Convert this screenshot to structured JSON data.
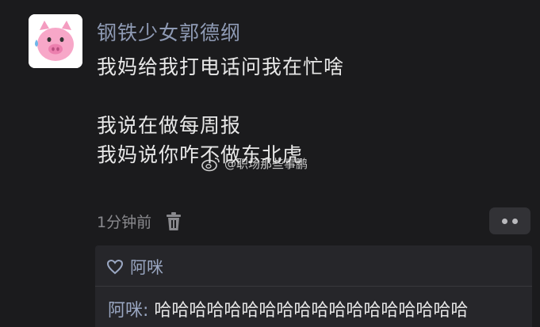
{
  "post": {
    "username": "钢铁少女郭德纲",
    "lines": [
      "我妈给我打电话问我在忙啥",
      "我说在做每周报",
      "我妈说你咋不做东北虎"
    ],
    "time": "1分钟前"
  },
  "watermark": {
    "text": "@职场那些事鹏"
  },
  "reply_panel": {
    "liker": "阿咪",
    "reply_name": "阿咪:",
    "reply_text": "哈哈哈哈哈哈哈哈哈哈哈哈哈哈哈哈哈哈"
  },
  "icons": {
    "avatar": "pig-face-sweat-icon",
    "delete": "trash-icon",
    "more": "more-dots-icon",
    "like": "heart-outline-icon",
    "weibo": "weibo-logo-icon"
  },
  "colors": {
    "background": "#1b1b1d",
    "username": "#8f9bb5",
    "text": "#e8e8e8",
    "meta": "#8a8a8e",
    "panel": "#26262a",
    "link": "#9aa7c2"
  }
}
